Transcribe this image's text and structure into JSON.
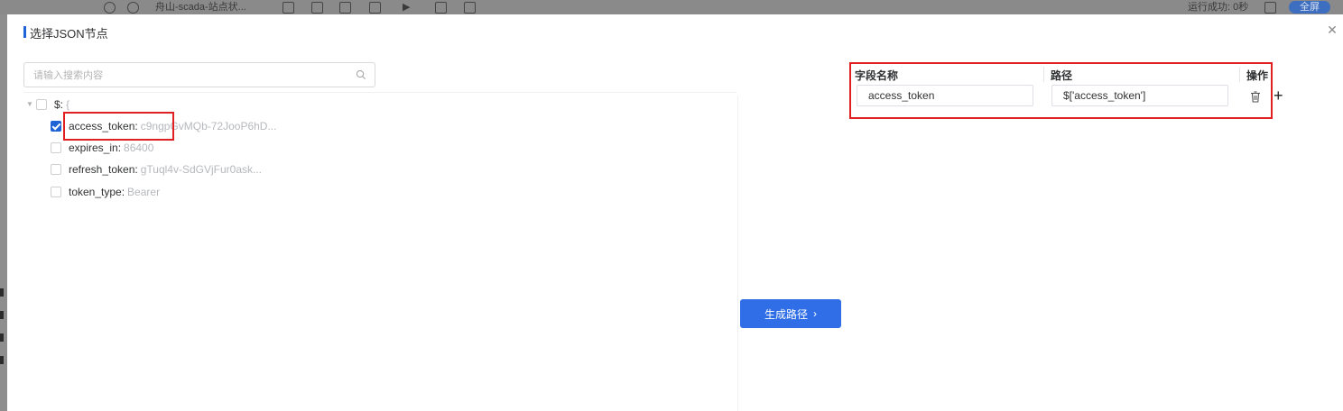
{
  "background_app": {
    "doc_tab": "舟山-scada-站点状...",
    "run_status": "运行成功: 0秒",
    "fullscreen_label": "全屏"
  },
  "modal": {
    "title": "选择JSON节点",
    "close_icon": "close-icon"
  },
  "search": {
    "placeholder": "请输入搜索内容",
    "value": ""
  },
  "tree": {
    "root": {
      "key": "$:",
      "value": "{",
      "checked": false
    },
    "nodes": [
      {
        "key": "access_token:",
        "value": "c9ngpGvMQb-72JooP6hD...",
        "checked": true
      },
      {
        "key": "expires_in:",
        "value": "86400",
        "checked": false
      },
      {
        "key": "refresh_token:",
        "value": "gTuql4v-SdGVjFur0ask...",
        "checked": false
      },
      {
        "key": "token_type:",
        "value": "Bearer",
        "checked": false
      }
    ]
  },
  "mapping_table": {
    "headers": {
      "field_name": "字段名称",
      "path": "路径",
      "actions": "操作"
    },
    "rows": [
      {
        "field_name": "access_token",
        "path": "$['access_token']"
      }
    ]
  },
  "generate_button": {
    "label": "生成路径"
  },
  "colors": {
    "accent": "#2f6ee6",
    "highlight_border": "#e02020",
    "checkbox_checked": "#1f63d6"
  }
}
